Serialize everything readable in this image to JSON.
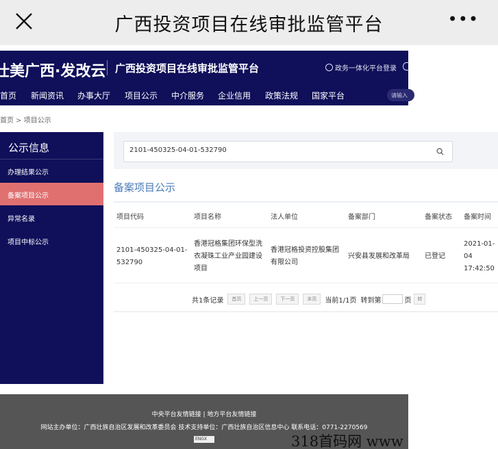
{
  "topbar": {
    "title": "广西投资项目在线审批监管平台",
    "more": "•••"
  },
  "header": {
    "logo": "壮美广西·发改云",
    "site_title": "广西投资项目在线审批监管平台",
    "login": "政务一体化平台登录"
  },
  "nav": {
    "items": [
      "首页",
      "新闻资讯",
      "办事大厅",
      "项目公示",
      "中介服务",
      "企业信用",
      "政策法规",
      "国家平台"
    ],
    "search_placeholder": "请输入"
  },
  "breadcrumb": "首页 > 项目公示",
  "sidebar": {
    "title": "公示信息",
    "items": [
      "办理结果公示",
      "备案项目公示",
      "异常名录",
      "项目中标公示"
    ],
    "active_index": 1
  },
  "search": {
    "value": "2101-450325-04-01-532790"
  },
  "section_title": "备案项目公示",
  "table": {
    "headers": [
      "项目代码",
      "项目名称",
      "法人单位",
      "备案部门",
      "备案状态",
      "备案时间"
    ],
    "row": {
      "code_l1": "2101-450325-04-01-",
      "code_l2": "532790",
      "name_l1": "香港冠格集团环保型洗",
      "name_l2": "衣凝珠工业产业园建设",
      "name_l3": "项目",
      "org_l1": "香港冠格投资控股集团",
      "org_l2": "有限公司",
      "dept": "兴安县发展和改革局",
      "status": "已登记",
      "time_l1": "2021-01-",
      "time_l2": "04",
      "time_l3": "17:42:50"
    }
  },
  "pager": {
    "total": "共1条记录",
    "first": "首页",
    "prev": "上一页",
    "next": "下一页",
    "last": "末页",
    "current": "当前1/1页",
    "jump_label": "转到第",
    "page_unit": "页",
    "go": "转"
  },
  "footer": {
    "links": "中央平台友情链接 | 地方平台友情链接",
    "info": "网站主办单位：广西壮族自治区发展和改革委员会 技术支持单位：广西壮族自治区信息中心 联系电话：0771-2270569",
    "badge": "ENGX"
  },
  "watermark": "318首码网 www"
}
